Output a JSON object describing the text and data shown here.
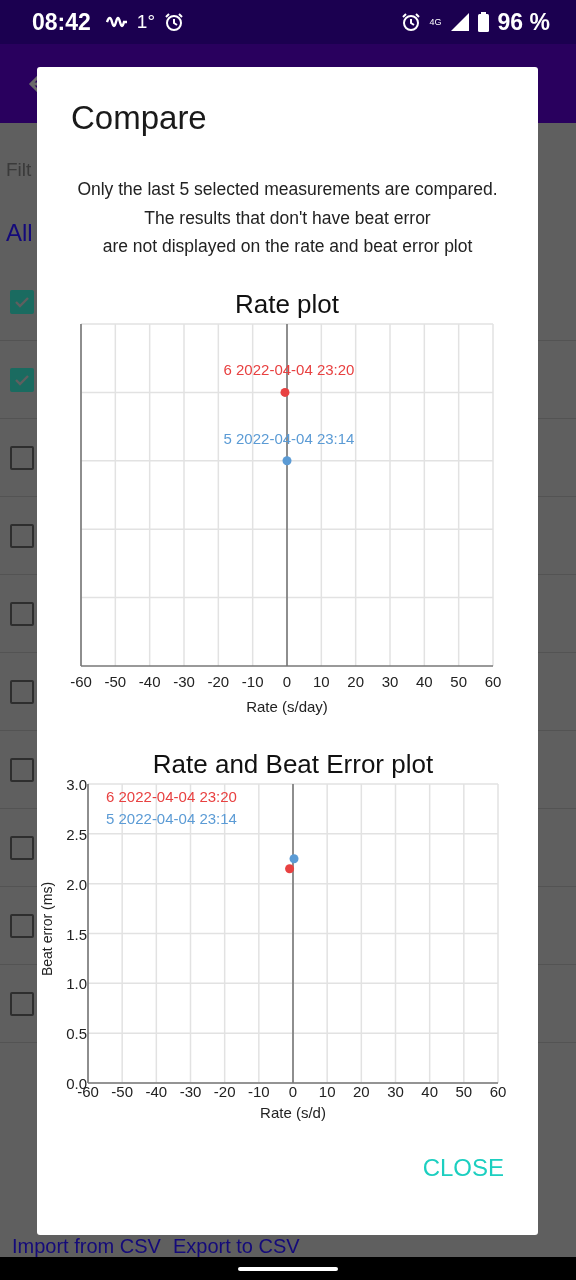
{
  "status_bar": {
    "time": "08:42",
    "temperature": "1°",
    "network": "4G",
    "battery": "96 %"
  },
  "background": {
    "filter_label": "Filt",
    "all_link": "All",
    "rows": [
      {
        "checked": true
      },
      {
        "checked": true
      },
      {
        "checked": false
      },
      {
        "checked": false
      },
      {
        "checked": false
      },
      {
        "checked": false
      },
      {
        "checked": false
      },
      {
        "checked": false
      },
      {
        "checked": false
      },
      {
        "checked": false
      }
    ],
    "import_link": "Import from CSV",
    "export_link": "Export to CSV"
  },
  "dialog": {
    "title": "Compare",
    "message": [
      "Only the last 5 selected measurements are compared.",
      "The results that don't have beat error",
      "are not displayed on the rate and beat error plot"
    ],
    "charts": [
      {
        "kind": "rate",
        "title": "Rate plot",
        "xlabel": "Rate (s/day)",
        "grid": true,
        "xtick_labels": [
          "-60",
          "-50",
          "-40",
          "-30",
          "-20",
          "-10",
          "0",
          "10",
          "20",
          "30",
          "40",
          "50",
          "60"
        ],
        "points": [
          {
            "label": "6 2022-04-04 23:20",
            "color": "#e84141"
          },
          {
            "label": "5 2022-04-04 23:14",
            "color": "#5b9bd5"
          }
        ]
      },
      {
        "kind": "chart",
        "chart_data": {
          "type": "scatter",
          "grid": true,
          "title": "Rate and Beat Error plot",
          "xlabel": "Rate (s/d)",
          "ylabel": "Beat error (ms)",
          "xlim": [
            -60,
            60
          ],
          "ylim": [
            0,
            3
          ],
          "xticks": [
            -60,
            -50,
            -40,
            -30,
            -20,
            -10,
            0,
            10,
            20,
            30,
            40,
            50,
            60
          ],
          "yticks": [
            {
              "value": 0,
              "label": "0.0"
            },
            {
              "value": 0.5,
              "label": "0.5"
            },
            {
              "value": 1,
              "label": "1.0"
            },
            {
              "value": 1.5,
              "label": "1.5"
            },
            {
              "value": 2,
              "label": "2.0"
            },
            {
              "value": 2.5,
              "label": "2.5"
            },
            {
              "value": 3,
              "label": "3.0"
            }
          ],
          "series": [
            {
              "name": "6 2022-04-04 23:20",
              "color": "#e84141",
              "x": [
                -1
              ],
              "values": [
                2.15
              ]
            },
            {
              "name": "5 2022-04-04 23:14",
              "color": "#5b9bd5",
              "x": [
                0.3
              ],
              "values": [
                2.25
              ]
            }
          ]
        }
      }
    ],
    "button": "CLOSE"
  }
}
